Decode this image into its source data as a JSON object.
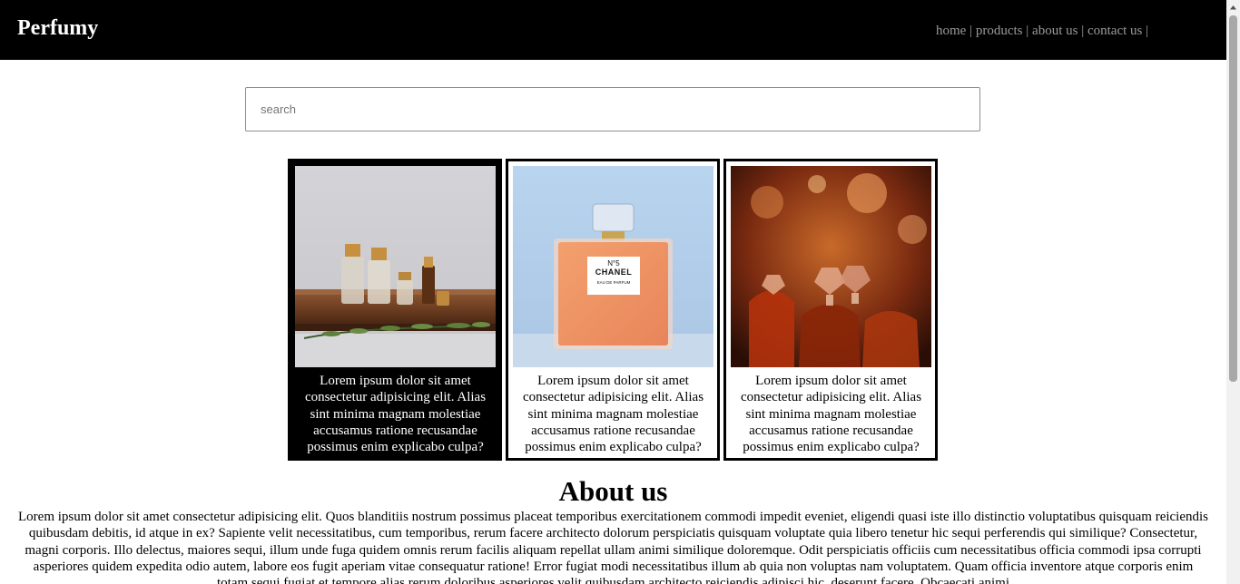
{
  "brand": "Perfumy",
  "nav": {
    "links": [
      "home",
      "products",
      "about us",
      "contact us"
    ],
    "separator": "|"
  },
  "search": {
    "placeholder": "search",
    "value": ""
  },
  "products": [
    {
      "image": "perfume bottles on wooden tray",
      "caption": "Lorem ipsum dolor sit amet consectetur adipisicing elit. Alias sint minima magnam molestiae accusamus ratione recusandae possimus enim explicabo culpa?"
    },
    {
      "image": "chanel no5 bottle",
      "caption": "Lorem ipsum dolor sit amet consectetur adipisicing elit. Alias sint minima magnam molestiae accusamus ratione recusandae possimus enim explicabo culpa?"
    },
    {
      "image": "crystal perfume bottles warm bokeh",
      "caption": "Lorem ipsum dolor sit amet consectetur adipisicing elit. Alias sint minima magnam molestiae accusamus ratione recusandae possimus enim explicabo culpa?"
    }
  ],
  "product_labels": {
    "chanel_no": "N°5",
    "chanel_brand": "CHANEL",
    "chanel_type": "EAU DE PARFUM"
  },
  "about": {
    "title": "About us",
    "text": "Lorem ipsum dolor sit amet consectetur adipisicing elit. Quos blanditiis nostrum possimus placeat temporibus exercitationem commodi impedit eveniet, eligendi quasi iste illo distinctio voluptatibus quisquam reiciendis quibusdam debitis, id atque in ex? Sapiente velit necessitatibus, cum temporibus, rerum facere architecto dolorum perspiciatis quisquam voluptate quia libero tenetur hic sequi perferendis qui similique? Consectetur, magni corporis. Illo delectus, maiores sequi, illum unde fuga quidem omnis rerum facilis aliquam repellat ullam animi similique doloremque. Odit perspiciatis officiis cum necessitatibus officia commodi ipsa corrupti asperiores quidem expedita odio autem, labore eos fugit aperiam vitae consequatur ratione! Error fugiat modi necessitatibus illum ab quia non voluptas nam voluptatem. Quam officia inventore atque corporis enim totam sequi fugiat et tempore alias rerum doloribus asperiores velit quibusdam architecto reiciendis adipisci hic, deserunt facere. Obcaecati animi"
  },
  "colors": {
    "header_bg": "#000000",
    "nav_link": "#9a9a9a",
    "brand": "#ffffff"
  }
}
